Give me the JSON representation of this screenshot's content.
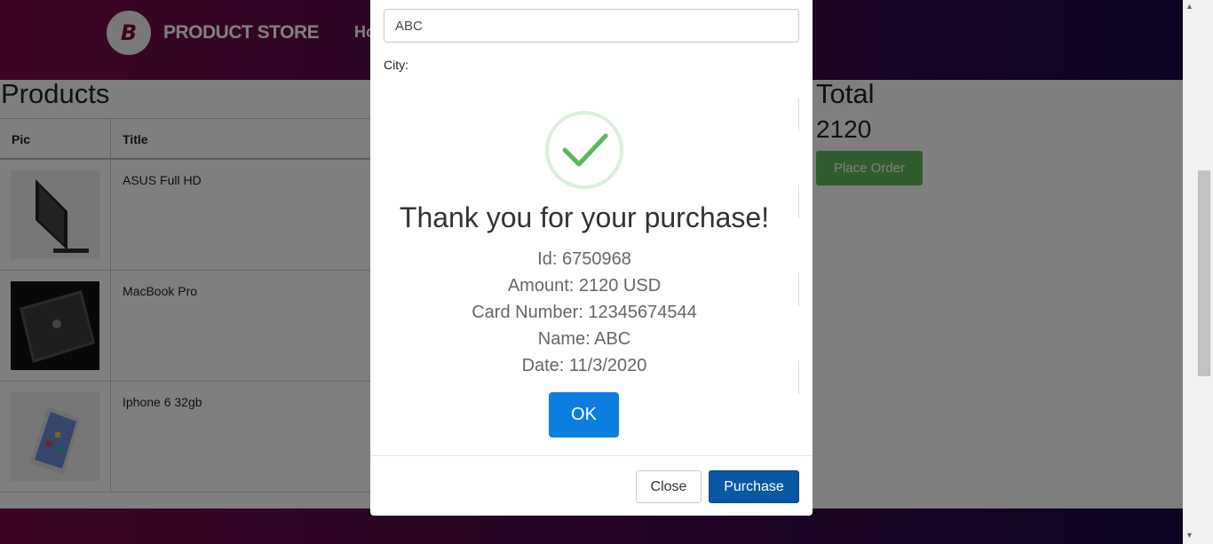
{
  "navbar": {
    "brand_name": "PRODUCT STORE",
    "brand_logo_letter": "B",
    "home_link_partial": "Ho"
  },
  "cart": {
    "title": "Products",
    "columns": [
      "Pic",
      "Title"
    ],
    "rows": [
      {
        "title": "ASUS Full HD",
        "image": "monitor-image"
      },
      {
        "title": "MacBook Pro",
        "image": "laptop-image"
      },
      {
        "title": "Iphone 6 32gb",
        "image": "phone-image"
      }
    ],
    "total_label": "Total",
    "total_value": "2120",
    "place_order_label": "Place Order"
  },
  "order_modal": {
    "name_value": "ABC",
    "city_label": "City:",
    "close_label": "Close",
    "purchase_label": "Purchase"
  },
  "alert": {
    "icon": "success-checkmark-icon",
    "title": "Thank you for your purchase!",
    "lines": [
      "Id: 6750968",
      "Amount: 2120 USD",
      "Card Number: 12345674544",
      "Name: ABC",
      "Date: 11/3/2020"
    ],
    "ok_label": "OK"
  },
  "colors": {
    "navbar_start": "#7a0a48",
    "navbar_end": "#190843",
    "success": "#5cb85c",
    "primary": "#0a58a4",
    "ok": "#0c7ee0"
  }
}
